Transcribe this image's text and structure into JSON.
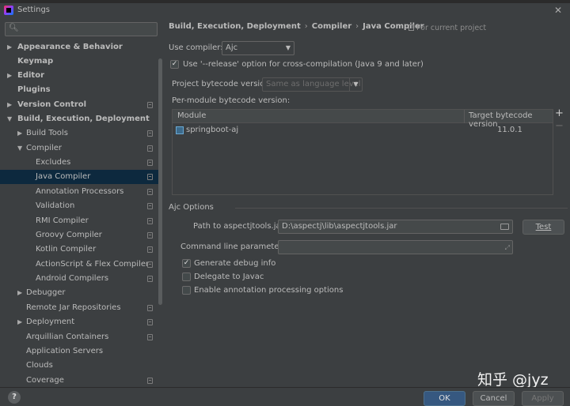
{
  "window": {
    "title": "Settings"
  },
  "search": {
    "placeholder": ""
  },
  "sidebar": {
    "items": [
      {
        "label": "Appearance & Behavior"
      },
      {
        "label": "Keymap"
      },
      {
        "label": "Editor"
      },
      {
        "label": "Plugins"
      },
      {
        "label": "Version Control"
      },
      {
        "label": "Build, Execution, Deployment"
      },
      {
        "label": "Build Tools"
      },
      {
        "label": "Compiler"
      },
      {
        "label": "Excludes"
      },
      {
        "label": "Java Compiler"
      },
      {
        "label": "Annotation Processors"
      },
      {
        "label": "Validation"
      },
      {
        "label": "RMI Compiler"
      },
      {
        "label": "Groovy Compiler"
      },
      {
        "label": "Kotlin Compiler"
      },
      {
        "label": "ActionScript & Flex Compiler"
      },
      {
        "label": "Android Compilers"
      },
      {
        "label": "Debugger"
      },
      {
        "label": "Remote Jar Repositories"
      },
      {
        "label": "Deployment"
      },
      {
        "label": "Arquillian Containers"
      },
      {
        "label": "Application Servers"
      },
      {
        "label": "Clouds"
      },
      {
        "label": "Coverage"
      }
    ]
  },
  "breadcrumb": {
    "part1": "Build, Execution, Deployment",
    "part2": "Compiler",
    "part3": "Java Compiler",
    "separator": "›"
  },
  "for_current_project": "For current project",
  "compiler": {
    "use_label": "Use compiler:",
    "value": "Ajc",
    "release_option_label": "Use '--release' option for cross-compilation (Java 9 and later)",
    "release_option_checked": true,
    "bytecode_label": "Project bytecode version:",
    "bytecode_placeholder": "Same as language level",
    "per_module_label": "Per-module bytecode version:"
  },
  "module_table": {
    "headers": [
      "Module",
      "Target bytecode version"
    ],
    "rows": [
      {
        "module": "springboot-aj",
        "version": "11.0.1"
      }
    ],
    "add_symbol": "+",
    "remove_symbol": "−"
  },
  "ajc": {
    "section_title": "Ajc Options",
    "path_label": "Path to aspectjtools.jar:",
    "path_value": "D:\\aspectj\\lib\\aspectjtools.jar",
    "test_button": "Test",
    "cmd_label": "Command line parameters:",
    "cmd_value": "",
    "generate_debug_label": "Generate debug info",
    "generate_debug_checked": true,
    "delegate_label": "Delegate to Javac",
    "delegate_checked": false,
    "annotation_label": "Enable annotation processing options",
    "annotation_checked": false
  },
  "footer": {
    "help": "?",
    "ok": "OK",
    "cancel": "Cancel",
    "apply": "Apply"
  },
  "watermark": "知乎 @jyz",
  "colors": {
    "background": "#3c3f41",
    "selection": "#0d293e",
    "primary_button": "#365880",
    "text": "#bbbbbb"
  }
}
